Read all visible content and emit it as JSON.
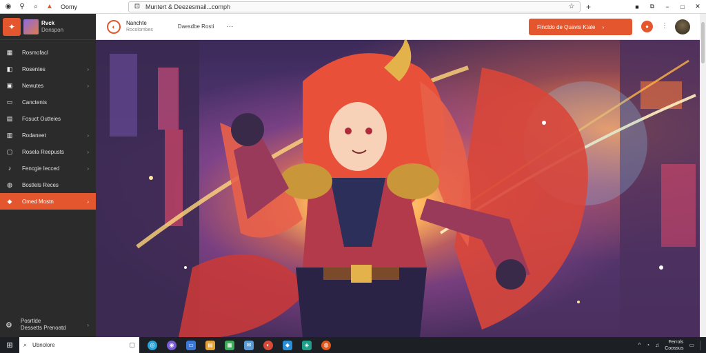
{
  "browser": {
    "tab_title": "Oomy",
    "url": "Muntert & Deezesmail...comph",
    "icons": [
      "browser-logo-icon",
      "pin-icon",
      "search-icon",
      "tab-favicon-icon"
    ],
    "new_tab_glyph": "+",
    "star_glyph": "☆",
    "window_controls": [
      "■",
      "⧉",
      "−",
      "□",
      "✕"
    ]
  },
  "sidebar": {
    "brand_line1": "Rvck",
    "brand_line2": "Denspon",
    "items": [
      {
        "label": "Rosmofacl",
        "icon": "grid-icon",
        "chevron": ""
      },
      {
        "label": "Rosentes",
        "icon": "layers-icon",
        "chevron": "›"
      },
      {
        "label": "Newutes",
        "icon": "image-icon",
        "chevron": "›"
      },
      {
        "label": "Canctents",
        "icon": "folder-icon",
        "chevron": ""
      },
      {
        "label": "Fosuct Outteies",
        "icon": "doc-icon",
        "chevron": ""
      },
      {
        "label": "Rodaneet",
        "icon": "book-icon",
        "chevron": "›"
      },
      {
        "label": "Rosela Reepusts",
        "icon": "screen-icon",
        "chevron": "›"
      },
      {
        "label": "Fencgie Iecced",
        "icon": "music-icon",
        "chevron": "›"
      },
      {
        "label": "Bostlels Reces",
        "icon": "camera-icon",
        "chevron": ""
      },
      {
        "label": "Omed Mostn",
        "icon": "fire-icon",
        "chevron": "›",
        "active": true
      }
    ],
    "footer_line1": "Posrtlde",
    "footer_line2": "Dessetts Prenoatd",
    "footer_chevron": "›"
  },
  "appbar": {
    "avatar_glyph": "◐",
    "name": "Nanchte",
    "sub": "Rocolombes",
    "crumb": "Daesdbe Rosti",
    "more": "···",
    "cta_label": "Fincldo de Quavis Ktale",
    "cta_arrow": "›",
    "circle_glyph": "●",
    "dots": "⋮"
  },
  "taskbar": {
    "start_glyph": "⊞",
    "search_text": "Ubnolore",
    "apps": [
      {
        "name": "app-1-icon",
        "color": "#2aa4d8"
      },
      {
        "name": "app-2-icon",
        "color": "#7a5ad0"
      },
      {
        "name": "app-3-icon",
        "color": "#3b78d6"
      },
      {
        "name": "app-4-icon",
        "color": "#e2a23a"
      },
      {
        "name": "app-5-icon",
        "color": "#3caa5a"
      },
      {
        "name": "app-6-icon",
        "color": "#5a9bd5"
      },
      {
        "name": "app-7-icon",
        "color": "#d64a3a"
      },
      {
        "name": "app-8-icon",
        "color": "#2a8fd6"
      },
      {
        "name": "app-9-icon",
        "color": "#1f9e8a"
      },
      {
        "name": "app-10-icon",
        "color": "#e0581c"
      }
    ],
    "tray_glyph": "^",
    "clock_line1": "Ferrols",
    "clock_line2": "Coossus"
  },
  "colors": {
    "accent": "#e4572e",
    "sidebar_bg": "#2b2b2b",
    "taskbar_bg": "#1c1f24"
  }
}
